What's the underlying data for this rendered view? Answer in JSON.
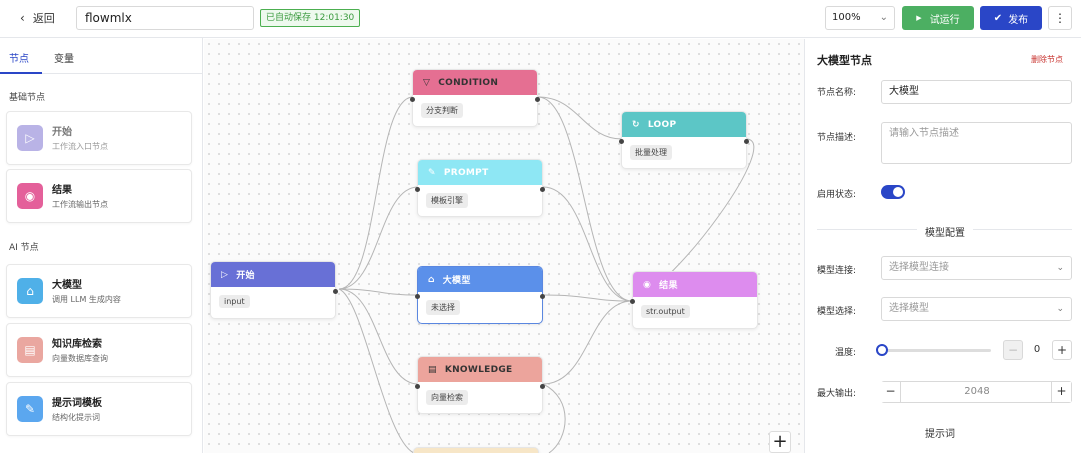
{
  "topbar": {
    "back_label": "返回",
    "workflow_name": "flowmlx",
    "autosave": "已自动保存 12:01:30",
    "zoom": "100%",
    "run_label": "试运行",
    "publish_label": "发布"
  },
  "sidebar": {
    "tabs": [
      "节点",
      "变量"
    ],
    "groups": [
      {
        "title": "基础节点",
        "items": [
          {
            "title": "开始",
            "sub": "工作流入口节点",
            "color": "#b9b3e6"
          },
          {
            "title": "结果",
            "sub": "工作流输出节点",
            "color": "#e4609a"
          }
        ]
      },
      {
        "title": "AI 节点",
        "items": [
          {
            "title": "大模型",
            "sub": "调用 LLM 生成内容",
            "color": "#4fb0e8"
          },
          {
            "title": "知识库检索",
            "sub": "向量数据库查询",
            "color": "#eaa7a0"
          },
          {
            "title": "提示词模板",
            "sub": "结构化提示词",
            "color": "#5ba7ef"
          }
        ]
      }
    ]
  },
  "canvas": {
    "nodes": {
      "start": {
        "title": "开始",
        "chip": "input",
        "color": "#6870d6"
      },
      "condition": {
        "title": "CONDITION",
        "chip": "分支判断",
        "color": "#e56f92"
      },
      "prompt": {
        "title": "PROMPT",
        "chip": "模板引擎",
        "color": "#8ee7f4"
      },
      "llm": {
        "title": "大模型",
        "chip": "未选择",
        "color": "#5b90ea"
      },
      "knowledge": {
        "title": "KNOWLEDGE",
        "chip": "向量检索",
        "color": "#eca49c"
      },
      "loop": {
        "title": "LOOP",
        "chip": "批量处理",
        "color": "#5cc6c6"
      },
      "result": {
        "title": "结果",
        "chip": "str.output",
        "color": "#dd8cee"
      }
    },
    "plus_label": "+"
  },
  "panel": {
    "title": "大模型节点",
    "delete_label": "删除节点",
    "name_label": "节点名称:",
    "name_value": "大模型",
    "desc_label": "节点描述:",
    "desc_placeholder": "请输入节点描述",
    "enable_label": "启用状态:",
    "enabled": true,
    "section_title": "模型配置",
    "provider_label": "模型连接:",
    "provider_placeholder": "选择模型连接",
    "model_label": "模型选择:",
    "model_placeholder": "选择模型",
    "temp_label": "温度:",
    "temp_value": "0",
    "temp_fraction": 0,
    "maxout_label": "最大输出:",
    "maxout_value": "2048",
    "prompt_label": "提示词"
  }
}
